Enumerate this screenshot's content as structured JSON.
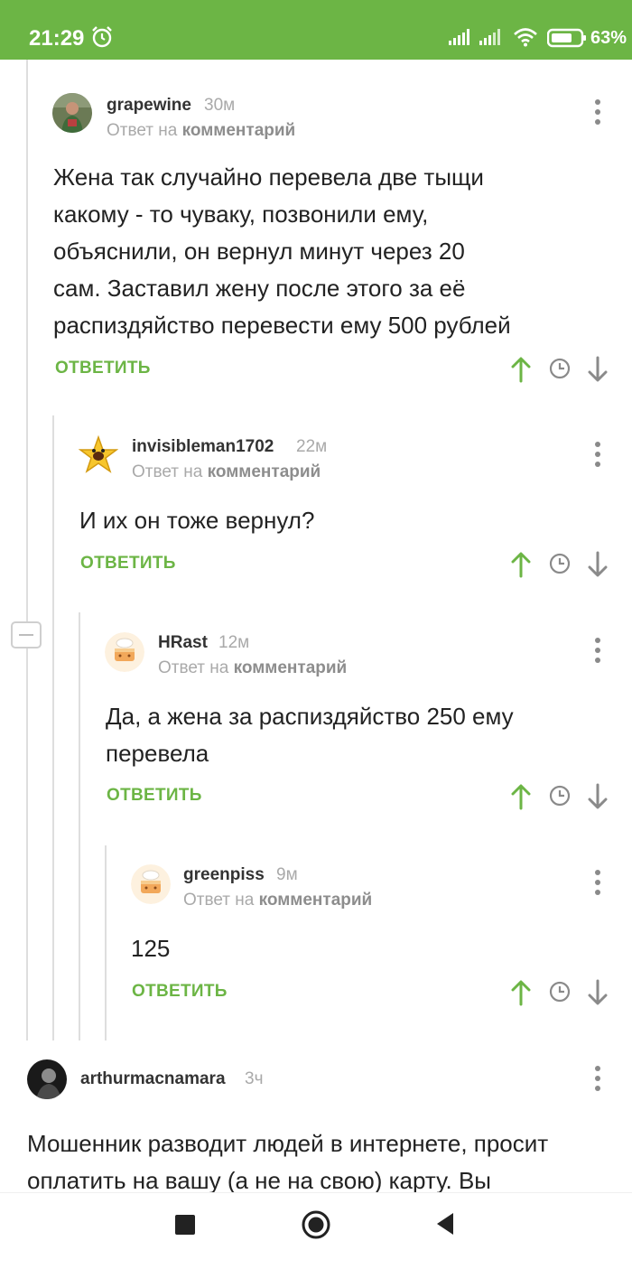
{
  "status_bar": {
    "time": "21:29",
    "battery": "63%"
  },
  "colors": {
    "accent": "#6cb545",
    "muted": "#a9a9a9",
    "text": "#222222"
  },
  "comments": [
    {
      "username": "grapewine",
      "time": "30м",
      "reply_prefix": "Ответ на",
      "reply_target": "комментарий",
      "text_lines": [
        "Жена так случайно перевела две тыщи",
        "какому - то чуваку, позвонили ему,",
        "объяснили, он вернул минут через 20",
        "сам. Заставил жену после этого за её",
        "распиздяйство перевести ему 500 рублей"
      ],
      "reply_label": "ОТВЕТИТЬ",
      "avatar": "photo-avatar"
    },
    {
      "username": "invisibleman1702",
      "time": "22м",
      "reply_prefix": "Ответ на",
      "reply_target": "комментарий",
      "text_lines": [
        "И их он тоже вернул?"
      ],
      "reply_label": "ОТВЕТИТЬ",
      "avatar": "star-avatar"
    },
    {
      "username": "HRast",
      "time": "12м",
      "reply_prefix": "Ответ на",
      "reply_target": "комментарий",
      "text_lines": [
        "Да, а жена за распиздяйство 250 ему",
        "перевела"
      ],
      "reply_label": "ОТВЕТИТЬ",
      "avatar": "cake-avatar"
    },
    {
      "username": "greenpiss",
      "time": "9м",
      "reply_prefix": "Ответ на",
      "reply_target": "комментарий",
      "text_lines": [
        "125"
      ],
      "reply_label": "ОТВЕТИТЬ",
      "avatar": "cake-avatar"
    },
    {
      "username": "arthurmacnamara",
      "time": "3ч",
      "text_lines": [
        "Мошенник разводит людей в интернете, просит",
        "оплатить на вашу (а не на свою) карту. Вы"
      ],
      "avatar": "dark-photo-avatar"
    }
  ]
}
